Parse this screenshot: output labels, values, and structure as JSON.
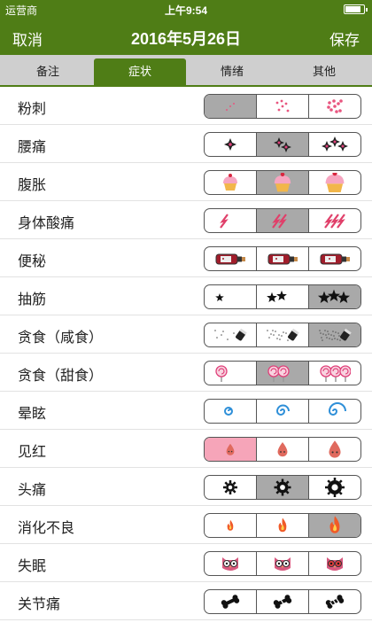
{
  "status_bar": {
    "carrier": "运营商",
    "time": "上午9:54",
    "battery_level": 0.85
  },
  "nav": {
    "cancel_label": "取消",
    "title": "2016年5月26日",
    "save_label": "保存"
  },
  "tabs": [
    {
      "label": "备注",
      "active": false
    },
    {
      "label": "症状",
      "active": true
    },
    {
      "label": "情绪",
      "active": false
    },
    {
      "label": "其他",
      "active": false
    }
  ],
  "symptoms": [
    {
      "label": "粉刺",
      "icon": "acne-icon",
      "selected": 0
    },
    {
      "label": "腰痛",
      "icon": "backache-sparkle-icon",
      "selected": 1
    },
    {
      "label": "腹胀",
      "icon": "cupcake-icon",
      "selected": 1
    },
    {
      "label": "身体酸痛",
      "icon": "lightning-icon",
      "selected": 1
    },
    {
      "label": "便秘",
      "icon": "bottle-icon",
      "selected": -1
    },
    {
      "label": "抽筋",
      "icon": "star-icon",
      "selected": 2
    },
    {
      "label": "贪食（咸食）",
      "icon": "salt-shaker-icon",
      "selected": 2
    },
    {
      "label": "贪食（甜食）",
      "icon": "lollipop-icon",
      "selected": 1
    },
    {
      "label": "晕眩",
      "icon": "spiral-icon",
      "selected": -1
    },
    {
      "label": "见红",
      "icon": "blood-drop-icon",
      "selected": 0,
      "sel_color": "pink"
    },
    {
      "label": "头痛",
      "icon": "gear-icon",
      "selected": 1
    },
    {
      "label": "消化不良",
      "icon": "flame-icon",
      "selected": 2
    },
    {
      "label": "失眠",
      "icon": "owl-icon",
      "selected": -1
    },
    {
      "label": "关节痛",
      "icon": "bone-icon",
      "selected": -1
    }
  ]
}
